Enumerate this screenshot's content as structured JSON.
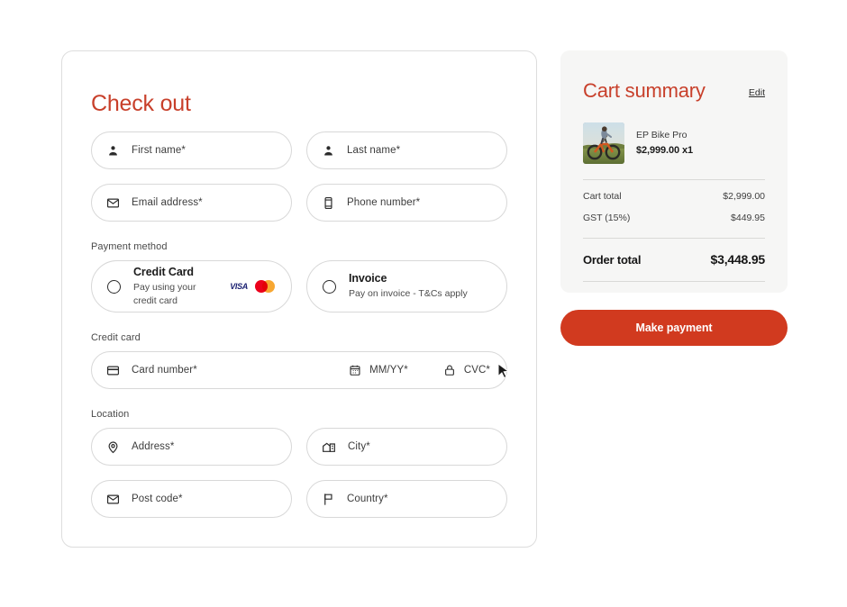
{
  "checkout": {
    "title": "Check out",
    "fields": {
      "first_name": "First name*",
      "last_name": "Last name*",
      "email": "Email address*",
      "phone": "Phone number*",
      "card_number": "Card number*",
      "expiry": "MM/YY*",
      "cvc": "CVC*",
      "address": "Address*",
      "city": "City*",
      "post_code": "Post code*",
      "country": "Country*"
    },
    "sections": {
      "payment_method": "Payment method",
      "credit_card": "Credit card",
      "location": "Location"
    },
    "payment_options": [
      {
        "title": "Credit Card",
        "subtitle": "Pay using your credit card",
        "selected": false,
        "brands": [
          "VISA",
          "mastercard"
        ]
      },
      {
        "title": "Invoice",
        "subtitle": "Pay on invoice - T&Cs apply",
        "selected": false,
        "brands": []
      }
    ],
    "visa_label": "VISA"
  },
  "cart": {
    "title": "Cart summary",
    "edit_label": "Edit",
    "item": {
      "name": "EP Bike Pro",
      "price_qty": "$2,999.00 x1"
    },
    "lines": [
      {
        "label": "Cart total",
        "value": "$2,999.00"
      },
      {
        "label": "GST (15%)",
        "value": "$449.95"
      }
    ],
    "order_total": {
      "label": "Order total",
      "value": "$3,448.95"
    },
    "pay_button": "Make payment"
  },
  "colors": {
    "brand_red": "#C8402B",
    "button_red": "#D13A1F",
    "panel_bg": "#F6F6F5",
    "border": "#d8d8d8"
  }
}
